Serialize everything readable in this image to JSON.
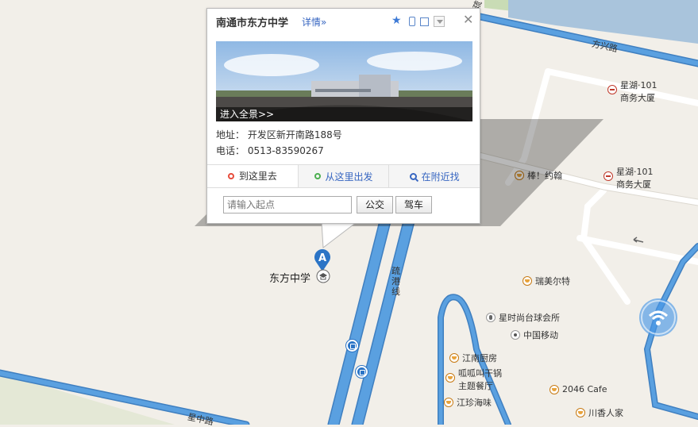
{
  "popup": {
    "title": "南通市东方中学",
    "detail_link": "详情»",
    "panorama_label": "进入全景>>",
    "address": "地址： 开发区新开南路188号",
    "phone": "电话： 0513-83590267",
    "tabs": [
      "到这里去",
      "从这里出发",
      "在附近找"
    ],
    "start_placeholder": "请输入起点",
    "bus_button": "公交",
    "drive_button": "驾车",
    "tool_icons": [
      "star-icon",
      "phone-icon",
      "edit-icon",
      "dropdown-icon"
    ]
  },
  "marker": {
    "letter": "A",
    "label": "东方中学"
  },
  "roads": {
    "fangxing": "方兴路",
    "shugang_1": "疏",
    "shugang_2": "港",
    "shugang_3": "线",
    "top_fragment": "疏",
    "bottom_fragment": "星中路"
  },
  "pois": [
    {
      "id": "xinghu-1",
      "line1": "星湖·101",
      "line2": "商务大厦",
      "icon": "hotel-icon"
    },
    {
      "id": "xinghu-2",
      "line1": "星湖·101",
      "line2": "商务大厦",
      "icon": "hotel-icon"
    },
    {
      "id": "bangyuehan",
      "name": "棒！约翰",
      "icon": "restaurant-icon"
    },
    {
      "id": "ruimeier",
      "name": "瑞美尔特",
      "icon": "restaurant-icon"
    },
    {
      "id": "xingshishang",
      "name": "星时尚台球会所",
      "icon": "entertainment-icon"
    },
    {
      "id": "chinamobile",
      "name": "中国移动",
      "icon": "place-icon"
    },
    {
      "id": "jiangnan",
      "name": "江南厨房",
      "icon": "restaurant-icon"
    },
    {
      "id": "guagua",
      "line1": "呱呱叫干锅",
      "line2": "主题餐厅",
      "icon": "restaurant-icon"
    },
    {
      "id": "2046",
      "name": "2046 Cafe",
      "icon": "restaurant-icon"
    },
    {
      "id": "jiangzhen",
      "name": "江珍海味",
      "icon": "restaurant-icon"
    },
    {
      "id": "chuanxiang",
      "name": "川香人家",
      "icon": "restaurant-icon"
    }
  ],
  "colors": {
    "road_blue": "#5aa0e0",
    "road_blue_edge": "#3f7fc0",
    "river": "#a9c4dc",
    "green": "#c9dcb5",
    "marker": "#2b74c6"
  }
}
